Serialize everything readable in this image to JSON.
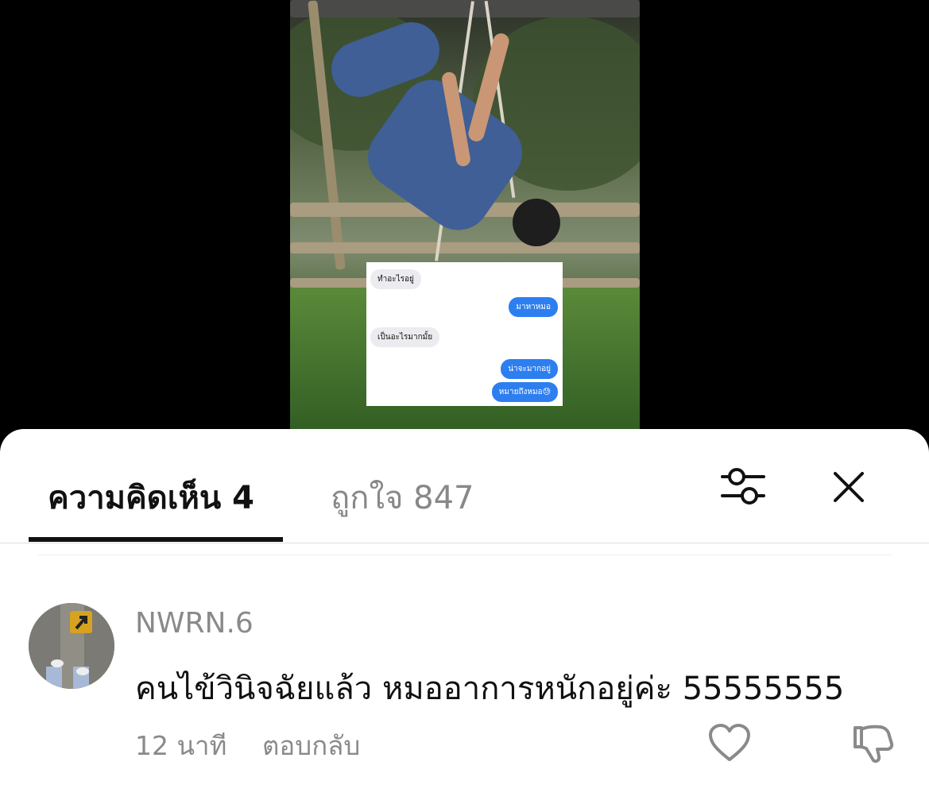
{
  "chat_overlay": {
    "messages": [
      {
        "side": "received",
        "text": "ทำอะไรอยู่"
      },
      {
        "side": "sent",
        "text": "มาหาหมอ"
      },
      {
        "side": "received",
        "text": "เป็นอะไรมากมั้ย"
      },
      {
        "side": "sent",
        "text": "น่าจะมากอยู่"
      },
      {
        "side": "sent",
        "text": "หมายถึงหมอ😓"
      }
    ]
  },
  "tabs": {
    "comments_label": "ความคิดเห็น 4",
    "likes_label": "ถูกใจ 847",
    "active": "comments"
  },
  "icons": {
    "filter": "filter-sliders-icon",
    "close": "close-icon",
    "like": "heart-outline-icon",
    "dislike": "thumbs-down-icon"
  },
  "comment": {
    "username": "NWRN.6",
    "text": "คนไข้วินิจฉัยแล้ว หมออาการหนักอยู่ค่ะ 55555555",
    "time": "12 นาที",
    "reply_label": "ตอบกลับ"
  },
  "colors": {
    "sent_bubble": "#2d7ff0",
    "received_bubble": "#ecebef",
    "muted_text": "#8a8a8a"
  }
}
